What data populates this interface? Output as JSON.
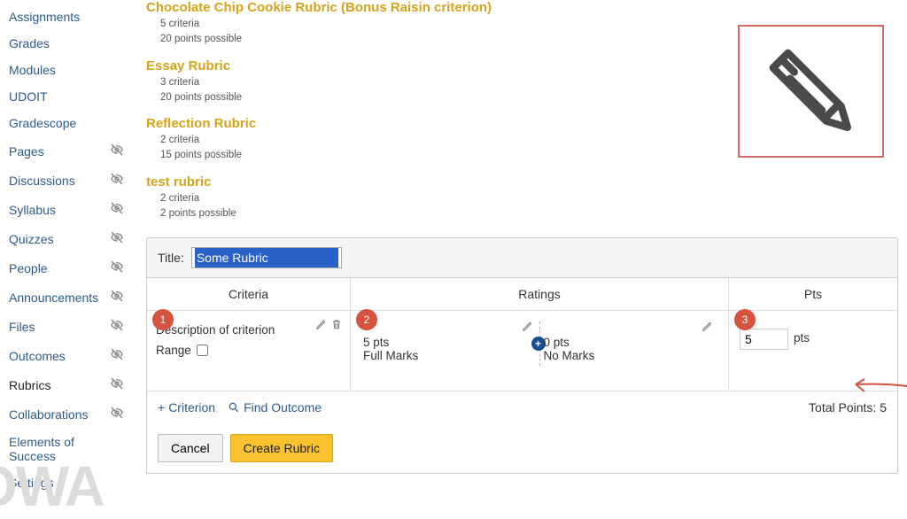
{
  "sidebar": {
    "items": [
      {
        "label": "Assignments",
        "hidden": false
      },
      {
        "label": "Grades",
        "hidden": false
      },
      {
        "label": "Modules",
        "hidden": false
      },
      {
        "label": "UDOIT",
        "hidden": false
      },
      {
        "label": "Gradescope",
        "hidden": false
      },
      {
        "label": "Pages",
        "hidden": true
      },
      {
        "label": "Discussions",
        "hidden": true
      },
      {
        "label": "Syllabus",
        "hidden": true
      },
      {
        "label": "Quizzes",
        "hidden": true
      },
      {
        "label": "People",
        "hidden": true
      },
      {
        "label": "Announcements",
        "hidden": true
      },
      {
        "label": "Files",
        "hidden": true
      },
      {
        "label": "Outcomes",
        "hidden": true
      },
      {
        "label": "Rubrics",
        "hidden": true,
        "active": true
      },
      {
        "label": "Collaborations",
        "hidden": true
      },
      {
        "label": "Elements of Success",
        "hidden": false
      },
      {
        "label": "Settings",
        "hidden": false
      }
    ],
    "watermark": "OWA"
  },
  "rubrics": [
    {
      "title": "Chocolate Chip Cookie Rubric (Bonus Raisin criterion)",
      "criteria": "5 criteria",
      "points": "20 points possible"
    },
    {
      "title": "Essay Rubric",
      "criteria": "3 criteria",
      "points": "20 points possible"
    },
    {
      "title": "Reflection Rubric",
      "criteria": "2 criteria",
      "points": "15 points possible"
    },
    {
      "title": "test rubric",
      "criteria": "2 criteria",
      "points": "2 points possible"
    }
  ],
  "editor": {
    "title_label": "Title:",
    "title_value": "Some Rubric",
    "columns": {
      "criteria": "Criteria",
      "ratings": "Ratings",
      "pts": "Pts"
    },
    "criterion_desc": "Description of criterion",
    "range_label": "Range",
    "ratings": [
      {
        "pts": "5 pts",
        "label": "Full Marks"
      },
      {
        "pts": "0 pts",
        "label": "No Marks"
      }
    ],
    "pts_value": "5",
    "pts_suffix": "pts",
    "add_criterion": "Criterion",
    "find_outcome": "Find Outcome",
    "total_label": "Total Points: ",
    "total_value": "5",
    "cancel": "Cancel",
    "create": "Create Rubric"
  },
  "annotations": {
    "badge1": "1",
    "badge2": "2",
    "badge3": "3"
  }
}
